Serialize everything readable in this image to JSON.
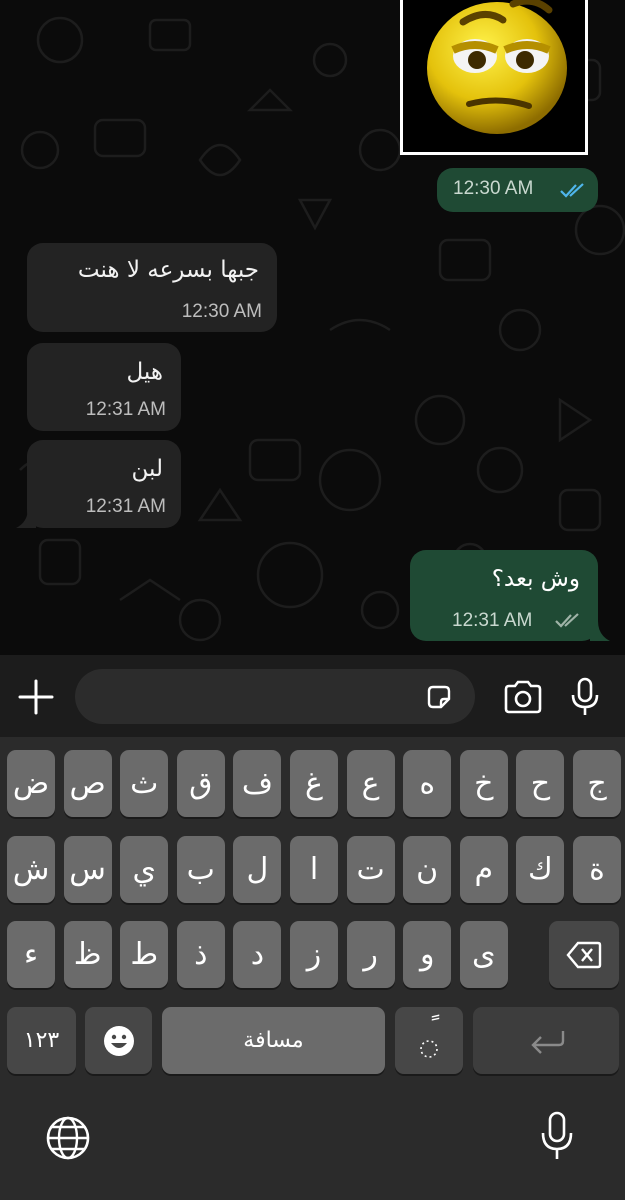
{
  "colors": {
    "chat_bg": "#0b0b0b",
    "incoming_bubble": "#232323",
    "outgoing_bubble": "#1f4a34",
    "read_ticks": "#4fb6ec",
    "key": "#6b6b6b",
    "key_dark": "#474747"
  },
  "messages": [
    {
      "direction": "out",
      "type": "image",
      "image_icon": "confused-emoji-sticker",
      "time": "12:30 AM",
      "status": "read"
    },
    {
      "direction": "in",
      "text": "جبها بسرعه لا هنت",
      "time": "12:30 AM"
    },
    {
      "direction": "in",
      "text": "هيل",
      "time": "12:31 AM"
    },
    {
      "direction": "in",
      "text": "لبن",
      "time": "12:31 AM"
    },
    {
      "direction": "out",
      "text": "وش بعد؟",
      "time": "12:31 AM",
      "status": "delivered"
    }
  ],
  "input_bar": {
    "icons": [
      "plus-icon",
      "sticker-icon",
      "camera-icon",
      "microphone-icon"
    ]
  },
  "keyboard": {
    "row1": [
      "ض",
      "ص",
      "ث",
      "ق",
      "ف",
      "غ",
      "ع",
      "ه",
      "خ",
      "ح",
      "ج"
    ],
    "row2": [
      "ش",
      "س",
      "ي",
      "ب",
      "ل",
      "ا",
      "ت",
      "ن",
      "م",
      "ك",
      "ة"
    ],
    "row3": [
      "ء",
      "ظ",
      "ط",
      "ذ",
      "د",
      "ز",
      "ر",
      "و",
      "ى"
    ],
    "numbers_key": "١٢٣",
    "space_key": "مسافة",
    "tanween_key": "ً",
    "icons": [
      "emoji-icon",
      "backspace-icon",
      "return-icon",
      "globe-icon",
      "dictation-mic-icon"
    ]
  }
}
